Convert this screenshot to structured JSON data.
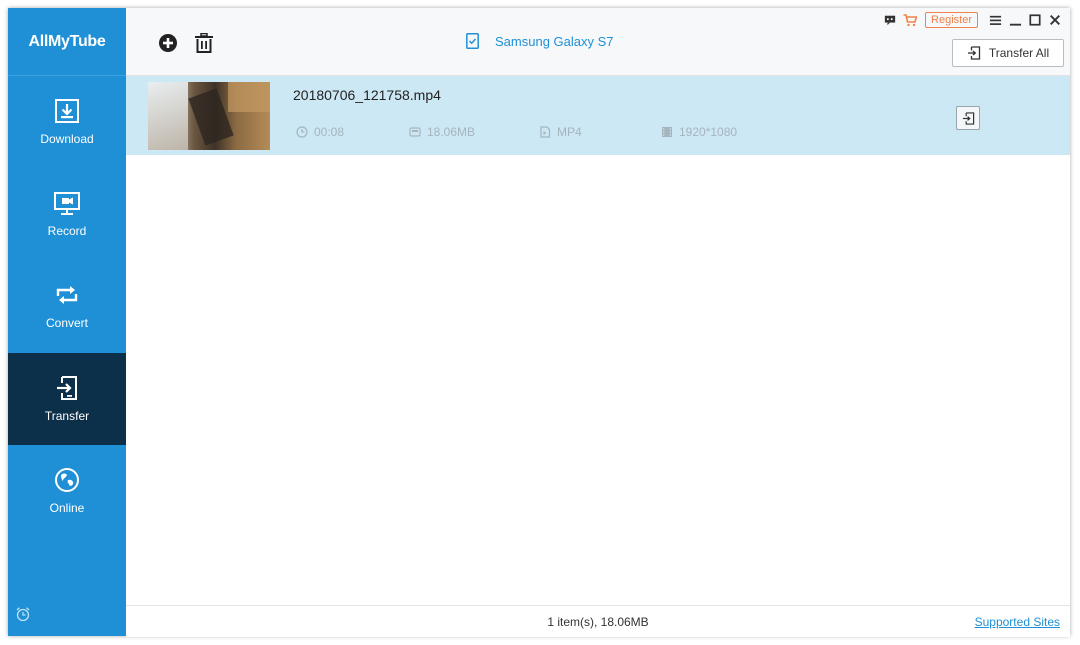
{
  "app": {
    "name": "AllMyTube"
  },
  "sidebar": {
    "items": [
      {
        "id": "download",
        "label": "Download",
        "icon": "download-icon"
      },
      {
        "id": "record",
        "label": "Record",
        "icon": "record-icon"
      },
      {
        "id": "convert",
        "label": "Convert",
        "icon": "convert-icon"
      },
      {
        "id": "transfer",
        "label": "Transfer",
        "icon": "transfer-icon",
        "active": true
      },
      {
        "id": "online",
        "label": "Online",
        "icon": "globe-icon"
      }
    ],
    "footer_icon": "alarm-clock-icon"
  },
  "toolbar": {
    "add_icon": "add-circle-icon",
    "delete_icon": "trash-icon",
    "device_name": "Samsung Galaxy S7",
    "register_label": "Register",
    "transfer_all_label": "Transfer All"
  },
  "files": [
    {
      "name": "20180706_121758.mp4",
      "duration": "00:08",
      "size": "18.06MB",
      "format": "MP4",
      "resolution": "1920*1080"
    }
  ],
  "status": {
    "summary": "1 item(s), 18.06MB",
    "link_label": "Supported Sites"
  },
  "colors": {
    "sidebar": "#1f90d6",
    "sidebar_active": "#0c2f4a",
    "row_selected": "#cde8f5",
    "accent_orange": "#f0824a"
  }
}
